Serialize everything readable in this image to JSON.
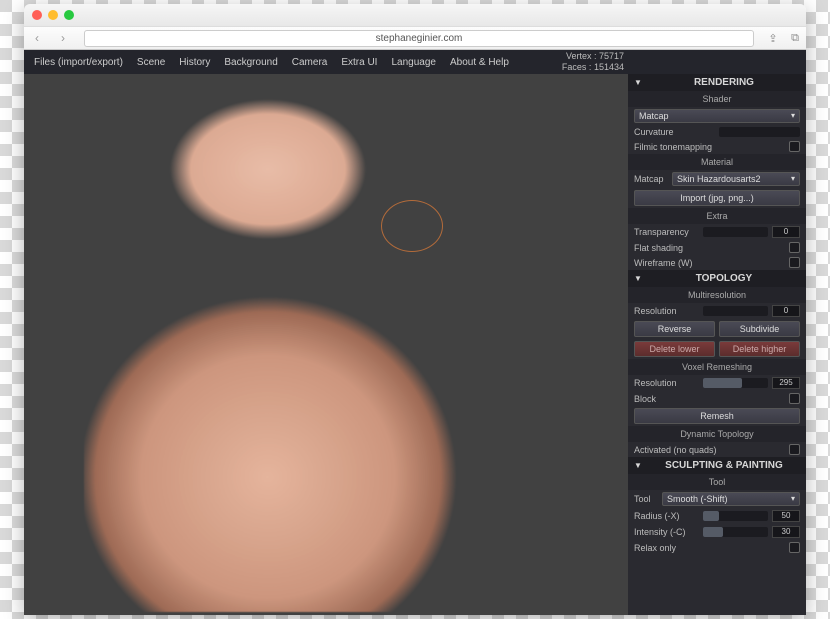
{
  "browser": {
    "url": "stephaneginier.com"
  },
  "menu": {
    "files": "Files (import/export)",
    "scene": "Scene",
    "history": "History",
    "background": "Background",
    "camera": "Camera",
    "extraui": "Extra UI",
    "language": "Language",
    "about": "About & Help"
  },
  "stats": {
    "vertex_label": "Vertex :",
    "vertex_value": "75717",
    "faces_label": "Faces :",
    "faces_value": "151434"
  },
  "panel": {
    "rendering": {
      "title": "RENDERING",
      "shader_h": "Shader",
      "shader_select": "Matcap",
      "curvature": "Curvature",
      "filmic": "Filmic tonemapping",
      "material_h": "Material",
      "matcap_lbl": "Matcap",
      "matcap_val": "Skin Hazardousarts2",
      "import_btn": "Import (jpg, png...)",
      "extra_h": "Extra",
      "transparency": "Transparency",
      "transparency_v": "0",
      "flat": "Flat shading",
      "wireframe": "Wireframe (W)"
    },
    "topology": {
      "title": "TOPOLOGY",
      "multires_h": "Multiresolution",
      "resolution": "Resolution",
      "resolution_v": "0",
      "reverse": "Reverse",
      "subdivide": "Subdivide",
      "del_lower": "Delete lower",
      "del_higher": "Delete higher",
      "voxel_h": "Voxel Remeshing",
      "resolution2": "Resolution",
      "resolution2_v": "295",
      "block": "Block",
      "remesh": "Remesh",
      "dyn_h": "Dynamic Topology",
      "activated": "Activated (no quads)"
    },
    "sculpt": {
      "title": "SCULPTING & PAINTING",
      "tool_h": "Tool",
      "tool_lbl": "Tool",
      "tool_val": "Smooth (-Shift)",
      "radius": "Radius (-X)",
      "radius_v": "50",
      "intensity": "Intensity (-C)",
      "intensity_v": "30",
      "relax": "Relax only"
    }
  }
}
